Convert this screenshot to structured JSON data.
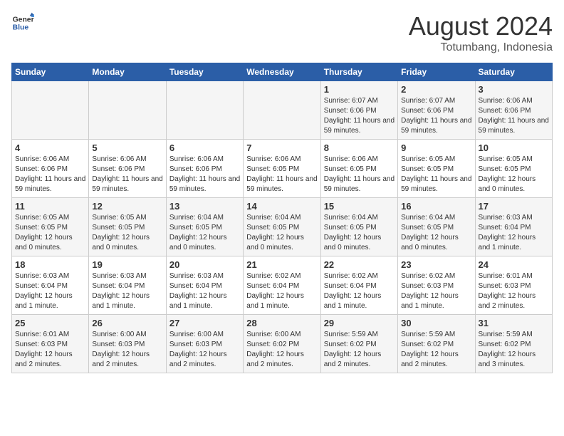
{
  "logo": {
    "line1": "General",
    "line2": "Blue"
  },
  "title": "August 2024",
  "subtitle": "Totumbang, Indonesia",
  "days_of_week": [
    "Sunday",
    "Monday",
    "Tuesday",
    "Wednesday",
    "Thursday",
    "Friday",
    "Saturday"
  ],
  "weeks": [
    [
      {
        "day": "",
        "sunrise": "",
        "sunset": "",
        "daylight": ""
      },
      {
        "day": "",
        "sunrise": "",
        "sunset": "",
        "daylight": ""
      },
      {
        "day": "",
        "sunrise": "",
        "sunset": "",
        "daylight": ""
      },
      {
        "day": "",
        "sunrise": "",
        "sunset": "",
        "daylight": ""
      },
      {
        "day": "1",
        "sunrise": "Sunrise: 6:07 AM",
        "sunset": "Sunset: 6:06 PM",
        "daylight": "Daylight: 11 hours and 59 minutes."
      },
      {
        "day": "2",
        "sunrise": "Sunrise: 6:07 AM",
        "sunset": "Sunset: 6:06 PM",
        "daylight": "Daylight: 11 hours and 59 minutes."
      },
      {
        "day": "3",
        "sunrise": "Sunrise: 6:06 AM",
        "sunset": "Sunset: 6:06 PM",
        "daylight": "Daylight: 11 hours and 59 minutes."
      }
    ],
    [
      {
        "day": "4",
        "sunrise": "Sunrise: 6:06 AM",
        "sunset": "Sunset: 6:06 PM",
        "daylight": "Daylight: 11 hours and 59 minutes."
      },
      {
        "day": "5",
        "sunrise": "Sunrise: 6:06 AM",
        "sunset": "Sunset: 6:06 PM",
        "daylight": "Daylight: 11 hours and 59 minutes."
      },
      {
        "day": "6",
        "sunrise": "Sunrise: 6:06 AM",
        "sunset": "Sunset: 6:06 PM",
        "daylight": "Daylight: 11 hours and 59 minutes."
      },
      {
        "day": "7",
        "sunrise": "Sunrise: 6:06 AM",
        "sunset": "Sunset: 6:05 PM",
        "daylight": "Daylight: 11 hours and 59 minutes."
      },
      {
        "day": "8",
        "sunrise": "Sunrise: 6:06 AM",
        "sunset": "Sunset: 6:05 PM",
        "daylight": "Daylight: 11 hours and 59 minutes."
      },
      {
        "day": "9",
        "sunrise": "Sunrise: 6:05 AM",
        "sunset": "Sunset: 6:05 PM",
        "daylight": "Daylight: 11 hours and 59 minutes."
      },
      {
        "day": "10",
        "sunrise": "Sunrise: 6:05 AM",
        "sunset": "Sunset: 6:05 PM",
        "daylight": "Daylight: 12 hours and 0 minutes."
      }
    ],
    [
      {
        "day": "11",
        "sunrise": "Sunrise: 6:05 AM",
        "sunset": "Sunset: 6:05 PM",
        "daylight": "Daylight: 12 hours and 0 minutes."
      },
      {
        "day": "12",
        "sunrise": "Sunrise: 6:05 AM",
        "sunset": "Sunset: 6:05 PM",
        "daylight": "Daylight: 12 hours and 0 minutes."
      },
      {
        "day": "13",
        "sunrise": "Sunrise: 6:04 AM",
        "sunset": "Sunset: 6:05 PM",
        "daylight": "Daylight: 12 hours and 0 minutes."
      },
      {
        "day": "14",
        "sunrise": "Sunrise: 6:04 AM",
        "sunset": "Sunset: 6:05 PM",
        "daylight": "Daylight: 12 hours and 0 minutes."
      },
      {
        "day": "15",
        "sunrise": "Sunrise: 6:04 AM",
        "sunset": "Sunset: 6:05 PM",
        "daylight": "Daylight: 12 hours and 0 minutes."
      },
      {
        "day": "16",
        "sunrise": "Sunrise: 6:04 AM",
        "sunset": "Sunset: 6:05 PM",
        "daylight": "Daylight: 12 hours and 0 minutes."
      },
      {
        "day": "17",
        "sunrise": "Sunrise: 6:03 AM",
        "sunset": "Sunset: 6:04 PM",
        "daylight": "Daylight: 12 hours and 1 minute."
      }
    ],
    [
      {
        "day": "18",
        "sunrise": "Sunrise: 6:03 AM",
        "sunset": "Sunset: 6:04 PM",
        "daylight": "Daylight: 12 hours and 1 minute."
      },
      {
        "day": "19",
        "sunrise": "Sunrise: 6:03 AM",
        "sunset": "Sunset: 6:04 PM",
        "daylight": "Daylight: 12 hours and 1 minute."
      },
      {
        "day": "20",
        "sunrise": "Sunrise: 6:03 AM",
        "sunset": "Sunset: 6:04 PM",
        "daylight": "Daylight: 12 hours and 1 minute."
      },
      {
        "day": "21",
        "sunrise": "Sunrise: 6:02 AM",
        "sunset": "Sunset: 6:04 PM",
        "daylight": "Daylight: 12 hours and 1 minute."
      },
      {
        "day": "22",
        "sunrise": "Sunrise: 6:02 AM",
        "sunset": "Sunset: 6:04 PM",
        "daylight": "Daylight: 12 hours and 1 minute."
      },
      {
        "day": "23",
        "sunrise": "Sunrise: 6:02 AM",
        "sunset": "Sunset: 6:03 PM",
        "daylight": "Daylight: 12 hours and 1 minute."
      },
      {
        "day": "24",
        "sunrise": "Sunrise: 6:01 AM",
        "sunset": "Sunset: 6:03 PM",
        "daylight": "Daylight: 12 hours and 2 minutes."
      }
    ],
    [
      {
        "day": "25",
        "sunrise": "Sunrise: 6:01 AM",
        "sunset": "Sunset: 6:03 PM",
        "daylight": "Daylight: 12 hours and 2 minutes."
      },
      {
        "day": "26",
        "sunrise": "Sunrise: 6:00 AM",
        "sunset": "Sunset: 6:03 PM",
        "daylight": "Daylight: 12 hours and 2 minutes."
      },
      {
        "day": "27",
        "sunrise": "Sunrise: 6:00 AM",
        "sunset": "Sunset: 6:03 PM",
        "daylight": "Daylight: 12 hours and 2 minutes."
      },
      {
        "day": "28",
        "sunrise": "Sunrise: 6:00 AM",
        "sunset": "Sunset: 6:02 PM",
        "daylight": "Daylight: 12 hours and 2 minutes."
      },
      {
        "day": "29",
        "sunrise": "Sunrise: 5:59 AM",
        "sunset": "Sunset: 6:02 PM",
        "daylight": "Daylight: 12 hours and 2 minutes."
      },
      {
        "day": "30",
        "sunrise": "Sunrise: 5:59 AM",
        "sunset": "Sunset: 6:02 PM",
        "daylight": "Daylight: 12 hours and 2 minutes."
      },
      {
        "day": "31",
        "sunrise": "Sunrise: 5:59 AM",
        "sunset": "Sunset: 6:02 PM",
        "daylight": "Daylight: 12 hours and 3 minutes."
      }
    ]
  ]
}
